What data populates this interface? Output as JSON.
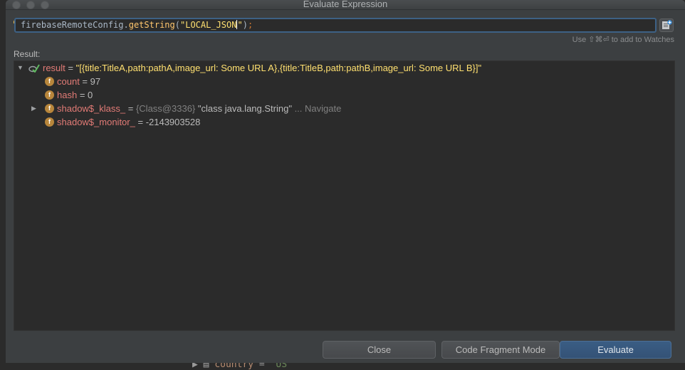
{
  "window": {
    "title": "Evaluate Expression"
  },
  "expression": {
    "tokens": [
      "firebaseRemoteConfig",
      ".",
      "getString",
      "(",
      "\"LOCAL_JSON",
      "\"",
      ")",
      ";"
    ],
    "watch_hint": "Use ⇧⌘⏎ to add to Watches"
  },
  "result": {
    "label": "Result:",
    "rows": [
      {
        "name": "result",
        "eq": " = ",
        "value": "\"[{title:TitleA,path:pathA,image_url: Some URL A},{title:TitleB,path:pathB,image_url: Some URL B}]\""
      },
      {
        "name": "count",
        "eq": " = ",
        "value": "97"
      },
      {
        "name": "hash",
        "eq": " = ",
        "value": "0"
      },
      {
        "name": "shadow$_klass_",
        "eq": " = ",
        "value_gray": "{Class@3336}",
        "value": " \"class java.lang.String\"",
        "navigate": " ... Navigate"
      },
      {
        "name": "shadow$_monitor_",
        "eq": " = ",
        "value": "-2143903528"
      }
    ]
  },
  "buttons": {
    "close": "Close",
    "code_fragment": "Code Fragment Mode",
    "evaluate": "Evaluate"
  },
  "background": {
    "bottom_name": "country",
    "bottom_eq": " = ",
    "bottom_value": "\"US\""
  },
  "colors": {
    "accent": "#3d6185",
    "field_name": "#e27b76",
    "string": "#ffe070",
    "icon_field": "#b8863b"
  }
}
